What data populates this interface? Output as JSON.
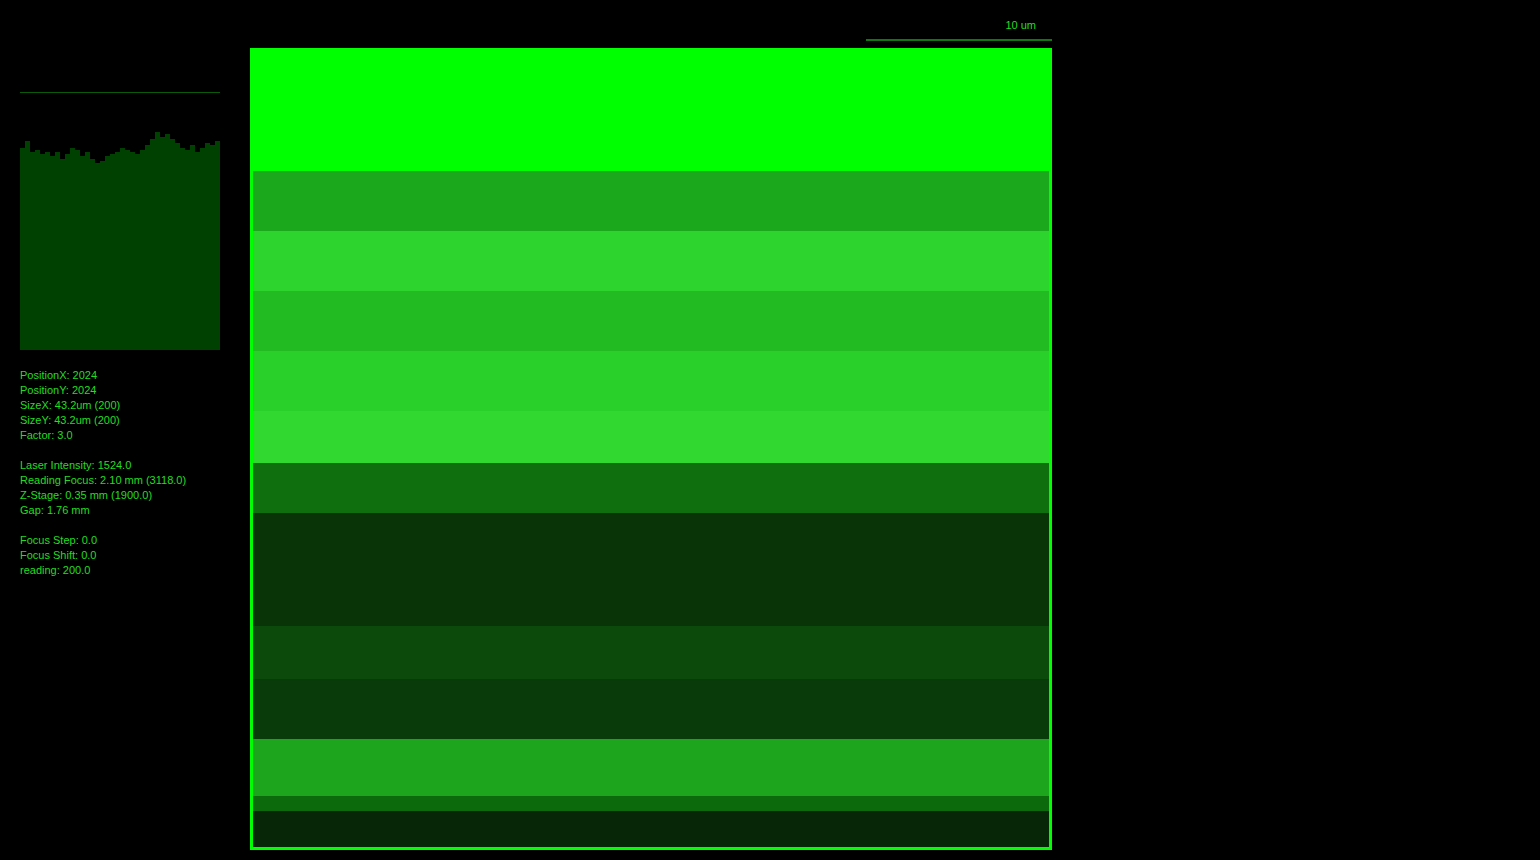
{
  "scale_bar": {
    "label": "10 um"
  },
  "histogram": {
    "values": [
      92,
      95,
      90,
      91,
      89,
      90,
      88,
      90,
      87,
      89,
      92,
      91,
      88,
      90,
      87,
      85,
      86,
      88,
      89,
      90,
      92,
      91,
      90,
      89,
      91,
      93,
      96,
      99,
      97,
      98,
      96,
      94,
      92,
      91,
      93,
      90,
      92,
      94,
      93,
      95
    ],
    "max": 100
  },
  "info_groups": [
    [
      "PositionX: 2024",
      "PositionY: 2024",
      "SizeX: 43.2um (200)",
      "SizeY: 43.2um (200)",
      "Factor: 3.0"
    ],
    [
      "Laser Intensity: 1524.0",
      "Reading Focus: 2.10 mm (3118.0)",
      "Z-Stage: 0.35 mm (1900.0)",
      "Gap: 1.76 mm"
    ],
    [
      "Focus Step: 0.0",
      "Focus Shift: 0.0",
      "reading: 200.0"
    ]
  ]
}
